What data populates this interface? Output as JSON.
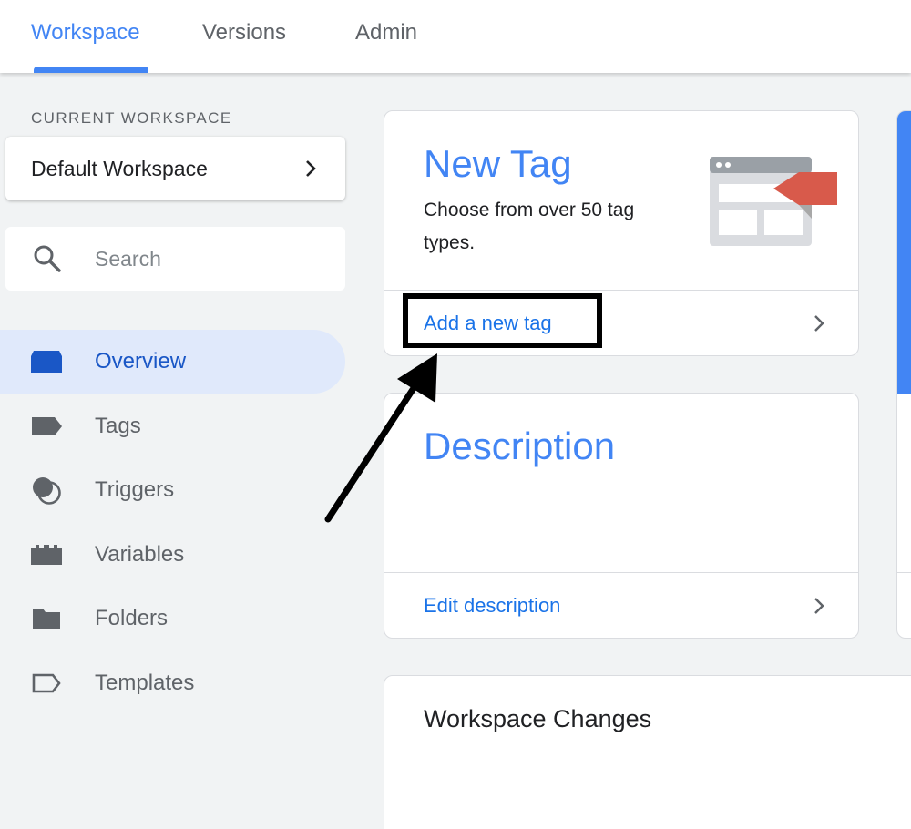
{
  "tabs": [
    {
      "label": "Workspace",
      "active": true
    },
    {
      "label": "Versions",
      "active": false
    },
    {
      "label": "Admin",
      "active": false
    }
  ],
  "sidebar": {
    "section_label": "CURRENT WORKSPACE",
    "workspace_name": "Default Workspace",
    "search_placeholder": "Search",
    "items": [
      {
        "label": "Overview",
        "icon": "overview-icon",
        "active": true
      },
      {
        "label": "Tags",
        "icon": "tag-icon",
        "active": false
      },
      {
        "label": "Triggers",
        "icon": "trigger-icon",
        "active": false
      },
      {
        "label": "Variables",
        "icon": "variable-icon",
        "active": false
      },
      {
        "label": "Folders",
        "icon": "folder-icon",
        "active": false
      },
      {
        "label": "Templates",
        "icon": "template-icon",
        "active": false
      }
    ]
  },
  "new_tag_card": {
    "title": "New Tag",
    "description": "Choose from over 50 tag types.",
    "link_label": "Add a new tag"
  },
  "description_card": {
    "title": "Description",
    "link_label": "Edit description"
  },
  "workspace_changes_card": {
    "title": "Workspace Changes"
  },
  "colors": {
    "accent": "#4285f4",
    "link": "#1a73e8",
    "active_nav_bg": "#e0e9fb",
    "tag_illustration_red": "#d85a4b"
  }
}
